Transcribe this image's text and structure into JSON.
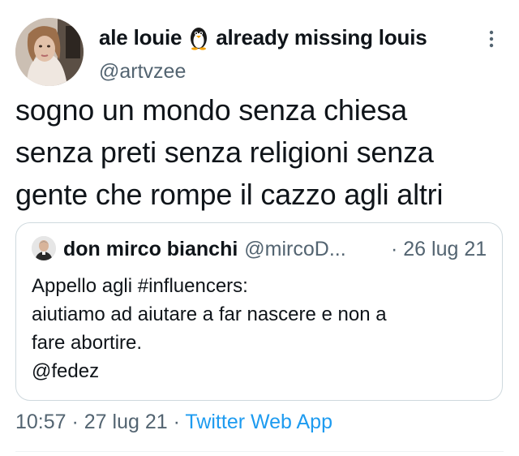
{
  "author": {
    "display_name": "ale louie",
    "display_suffix": "already missing louis",
    "handle": "@artvzee"
  },
  "tweet": {
    "text": "sogno un mondo senza chiesa\nsenza preti senza religioni senza\ngente che rompe il cazzo agli altri"
  },
  "quoted_tweet": {
    "name": "don mirco bianchi",
    "handle": "@mircoD...",
    "date": "· 26 lug 21",
    "lines": [
      "Appello agli #influencers:",
      "aiutiamo ad aiutare a far nascere e non a",
      "fare abortire.",
      "@fedez"
    ]
  },
  "meta": {
    "time": "10:57",
    "sep1": " · ",
    "date": "27 lug 21",
    "sep2": " · ",
    "source": "Twitter Web App"
  },
  "icons": {
    "author_emoji": "penguin-icon",
    "more": "more-options-icon"
  },
  "colors": {
    "link": "#1d9bf0",
    "secondary_text": "#536471",
    "border": "#cfd9de"
  }
}
